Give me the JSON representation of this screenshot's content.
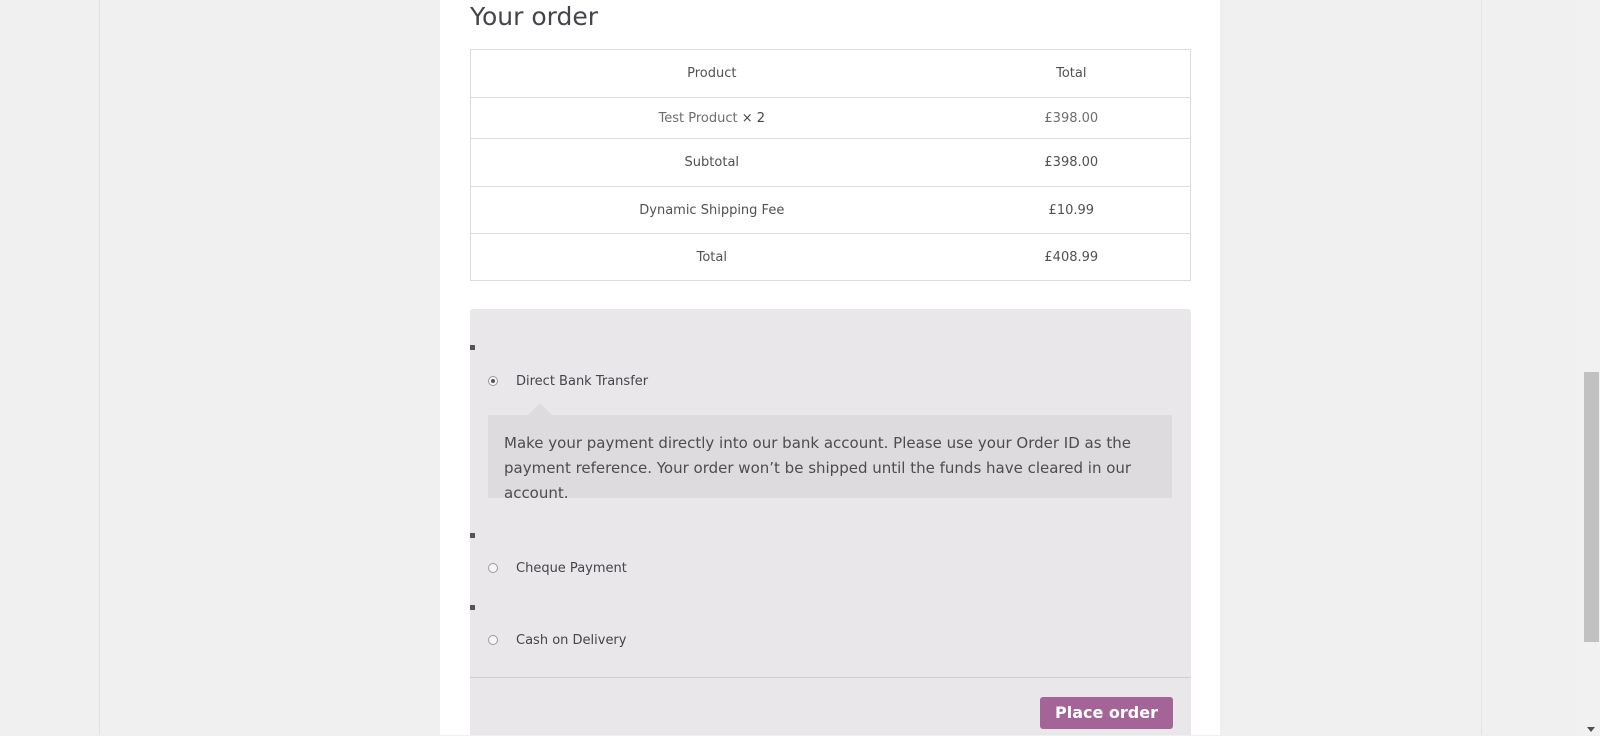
{
  "order": {
    "heading": "Your order",
    "table": {
      "header": {
        "product": "Product",
        "total": "Total"
      },
      "item": {
        "name": "Test Product",
        "qty": "× 2",
        "total": "£398.00"
      },
      "subtotal": {
        "label": "Subtotal",
        "value": "£398.00"
      },
      "shipping": {
        "label": "Dynamic Shipping Fee",
        "value": "£10.99"
      },
      "total": {
        "label": "Total",
        "value": "£408.99"
      }
    }
  },
  "payment": {
    "methods": [
      {
        "label": "Direct Bank Transfer",
        "selected": true
      },
      {
        "label": "Cheque Payment",
        "selected": false
      },
      {
        "label": "Cash on Delivery",
        "selected": false
      }
    ],
    "description": "Make your payment directly into our bank account. Please use your Order ID as the payment reference. Your order won’t be shipped until the funds have cleared in our account.",
    "place_order_label": "Place order"
  },
  "colors": {
    "accent": "#a46497",
    "payment_bg": "#e9e7ea",
    "description_bg": "#dddbdd"
  }
}
